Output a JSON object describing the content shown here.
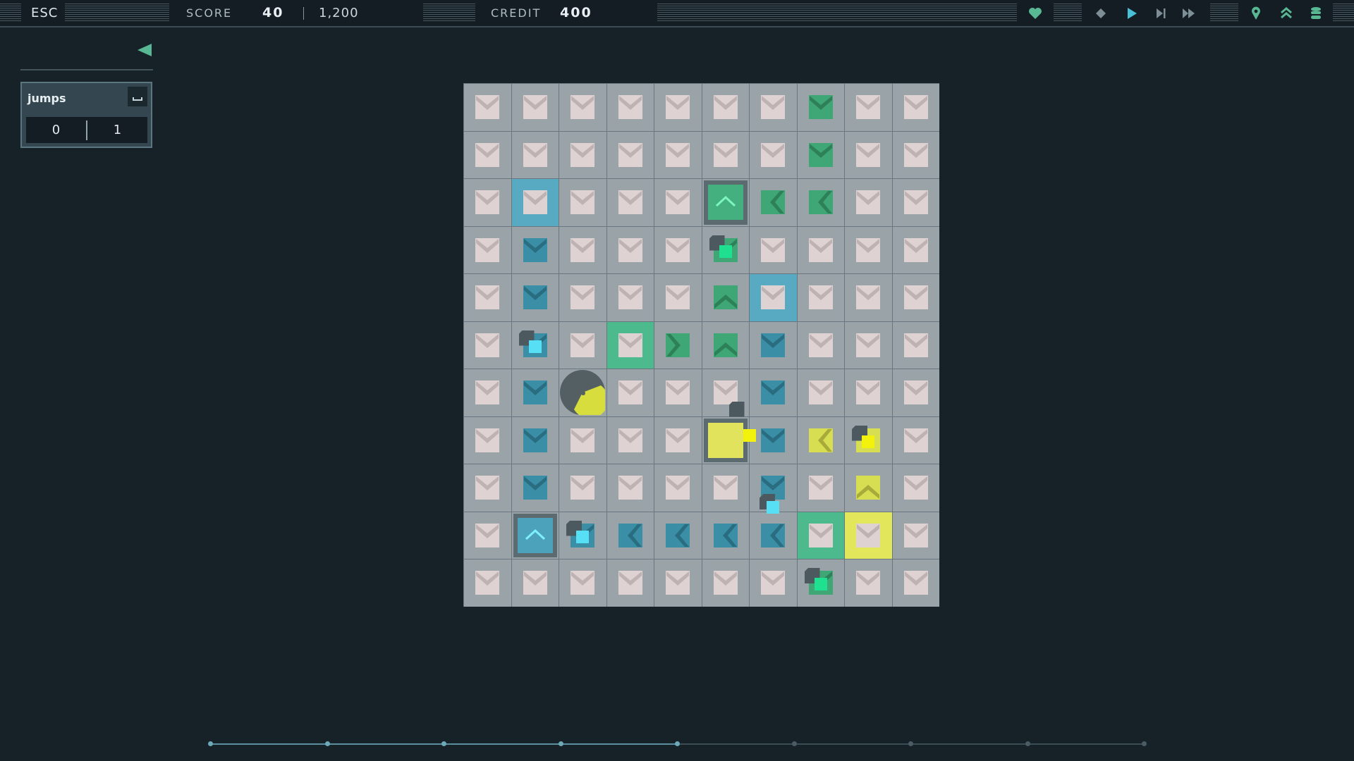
{
  "topbar": {
    "esc_label": "ESC",
    "score_label": "SCORE",
    "score_value": "40",
    "score_target": "1,200",
    "credit_label": "CREDIT",
    "credit_value": "400",
    "icons": [
      "heart-icon",
      "diamond-icon",
      "play-icon",
      "step-icon",
      "fast-forward-icon",
      "map-pin-icon",
      "chevrons-up-icon",
      "database-icon"
    ]
  },
  "panel": {
    "variable_name": "jumps",
    "values": [
      "0",
      "1"
    ]
  },
  "colors": {
    "background": "#162128",
    "tile": "#ded2d3",
    "blue": "#3a8ea6",
    "green": "#3fa676",
    "yellow": "#d8de52",
    "bot_cyan": "#57e0f5",
    "bot_green": "#1fe08e",
    "bot_yellow": "#f2f20d",
    "accent": "#58b894"
  },
  "board": {
    "rows": 11,
    "cols": 10,
    "legend": "Tile codes: '.' white down-arrow, d/u/l/r colored arrow (blue B, green G, yellow Y), '#' highlighted cell",
    "cells": [
      [
        ".",
        ".",
        ".",
        ".",
        ".",
        ".",
        ".",
        "Gd",
        ".",
        "."
      ],
      [
        ".",
        ".",
        ".",
        ".",
        ".",
        ".",
        ".",
        "Gd",
        ".",
        "."
      ],
      [
        ".",
        "hlB.",
        ".",
        ".",
        ".",
        "padGu",
        "Gl",
        "Gl",
        ".",
        "."
      ],
      [
        ".",
        "Bd",
        ".",
        ".",
        ".",
        "Gd",
        ".",
        ".",
        ".",
        "."
      ],
      [
        ".",
        "Bd",
        ".",
        ".",
        ".",
        "Gu",
        "hlB.",
        ".",
        ".",
        "."
      ],
      [
        ".",
        "Bd",
        ".",
        "hlG.",
        "Gr",
        "Gu",
        "Bd",
        ".",
        ".",
        "."
      ],
      [
        ".",
        "Bd",
        "pac",
        ".",
        ".",
        ".",
        "Bd",
        ".",
        ".",
        "."
      ],
      [
        ".",
        "Bd",
        ".",
        ".",
        ".",
        "padY",
        "Bd",
        "Yl",
        "Y.",
        "."
      ],
      [
        ".",
        "Bd",
        ".",
        ".",
        ".",
        ".",
        "Bd",
        ".",
        "Yu",
        "."
      ],
      [
        ".",
        "padBu",
        "Bd",
        "Bl",
        "Bl",
        "Bl",
        "Bl",
        "hlG.",
        "hlY.",
        "."
      ],
      [
        ".",
        ".",
        ".",
        ".",
        ".",
        ".",
        ".",
        "Gd",
        ".",
        "."
      ]
    ],
    "bots": [
      {
        "row": 3,
        "col": 5,
        "color": "green"
      },
      {
        "row": 5,
        "col": 1,
        "color": "cyan"
      },
      {
        "row": 7,
        "col": 5,
        "color": "yellow",
        "variant": "side"
      },
      {
        "row": 7,
        "col": 8,
        "color": "yellow"
      },
      {
        "row": 8,
        "col": 6,
        "color": "cyan",
        "variant": "low"
      },
      {
        "row": 9,
        "col": 2,
        "color": "cyan"
      },
      {
        "row": 10,
        "col": 7,
        "color": "green"
      }
    ]
  },
  "timeline": {
    "ticks": 9,
    "active_until": 5
  }
}
